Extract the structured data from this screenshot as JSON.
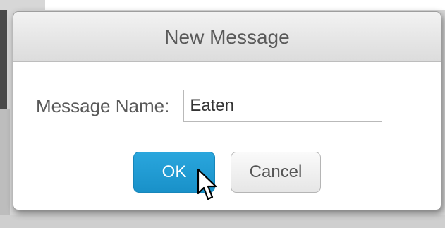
{
  "dialog": {
    "title": "New Message",
    "field_label": "Message Name:",
    "name_value": "Eaten",
    "ok_label": "OK",
    "cancel_label": "Cancel"
  },
  "colors": {
    "ok_button": "#1f9ad3",
    "title_text": "#5a5a5a",
    "label_text": "#595959"
  },
  "icons": {
    "cursor": "mouse-pointer-icon"
  }
}
